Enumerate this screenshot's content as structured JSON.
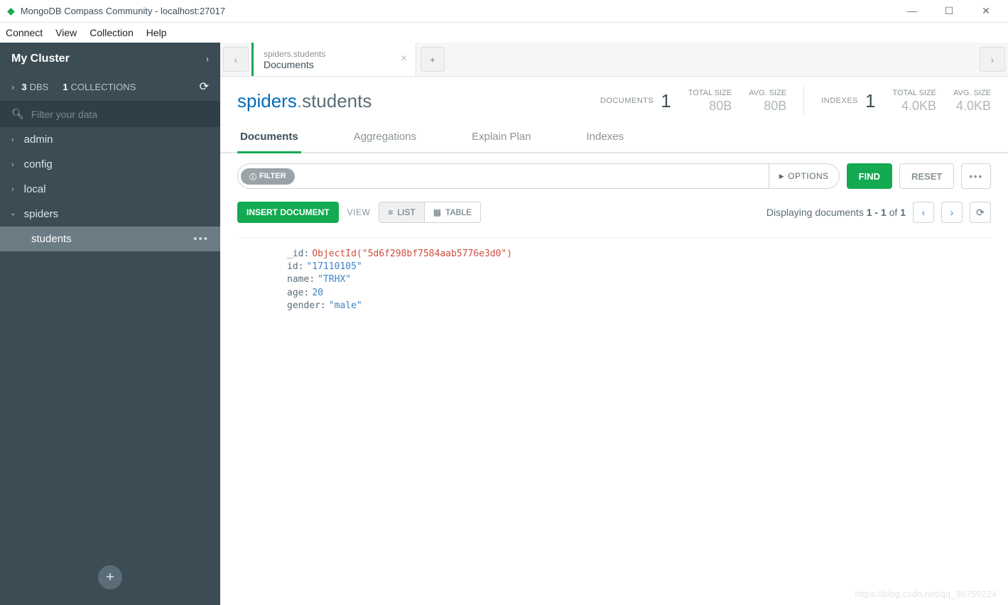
{
  "titlebar": {
    "app": "MongoDB Compass Community",
    "host": "localhost:27017"
  },
  "menu": [
    "Connect",
    "View",
    "Collection",
    "Help"
  ],
  "sidebar": {
    "cluster": "My Cluster",
    "dbs_count": "3",
    "dbs_label": "DBS",
    "colls_count": "1",
    "colls_label": "COLLECTIONS",
    "search_placeholder": "Filter your data",
    "dbs": [
      {
        "name": "admin",
        "open": false
      },
      {
        "name": "config",
        "open": false
      },
      {
        "name": "local",
        "open": false
      },
      {
        "name": "spiders",
        "open": true,
        "collections": [
          "students"
        ]
      }
    ]
  },
  "tab": {
    "path": "spiders.students",
    "section": "Documents"
  },
  "header": {
    "db": "spiders",
    "coll": "students",
    "docs_label": "DOCUMENTS",
    "docs_count": "1",
    "total_size_label": "TOTAL SIZE",
    "total_size": "80B",
    "avg_size_label": "AVG. SIZE",
    "avg_size": "80B",
    "idx_label": "INDEXES",
    "idx_count": "1",
    "idx_total_size": "4.0KB",
    "idx_avg_size": "4.0KB"
  },
  "subtabs": [
    "Documents",
    "Aggregations",
    "Explain Plan",
    "Indexes"
  ],
  "filter": {
    "badge": "FILTER",
    "options": "OPTIONS",
    "find": "FIND",
    "reset": "RESET"
  },
  "actionbar": {
    "insert": "INSERT DOCUMENT",
    "view": "VIEW",
    "list": "LIST",
    "table": "TABLE",
    "display_prefix": "Displaying documents ",
    "range": "1 - 1",
    "of": " of ",
    "total": "1"
  },
  "document": {
    "fields": [
      {
        "key": "_id",
        "type": "oid",
        "value": "ObjectId(\"5d6f298bf7584aab5776e3d0\")"
      },
      {
        "key": "id",
        "type": "str",
        "value": "\"17110105\""
      },
      {
        "key": "name",
        "type": "str",
        "value": "\"TRHX\""
      },
      {
        "key": "age",
        "type": "num",
        "value": "20"
      },
      {
        "key": "gender",
        "type": "str",
        "value": "\"male\""
      }
    ]
  },
  "watermark": "https://blog.csdn.net/qq_36759224"
}
